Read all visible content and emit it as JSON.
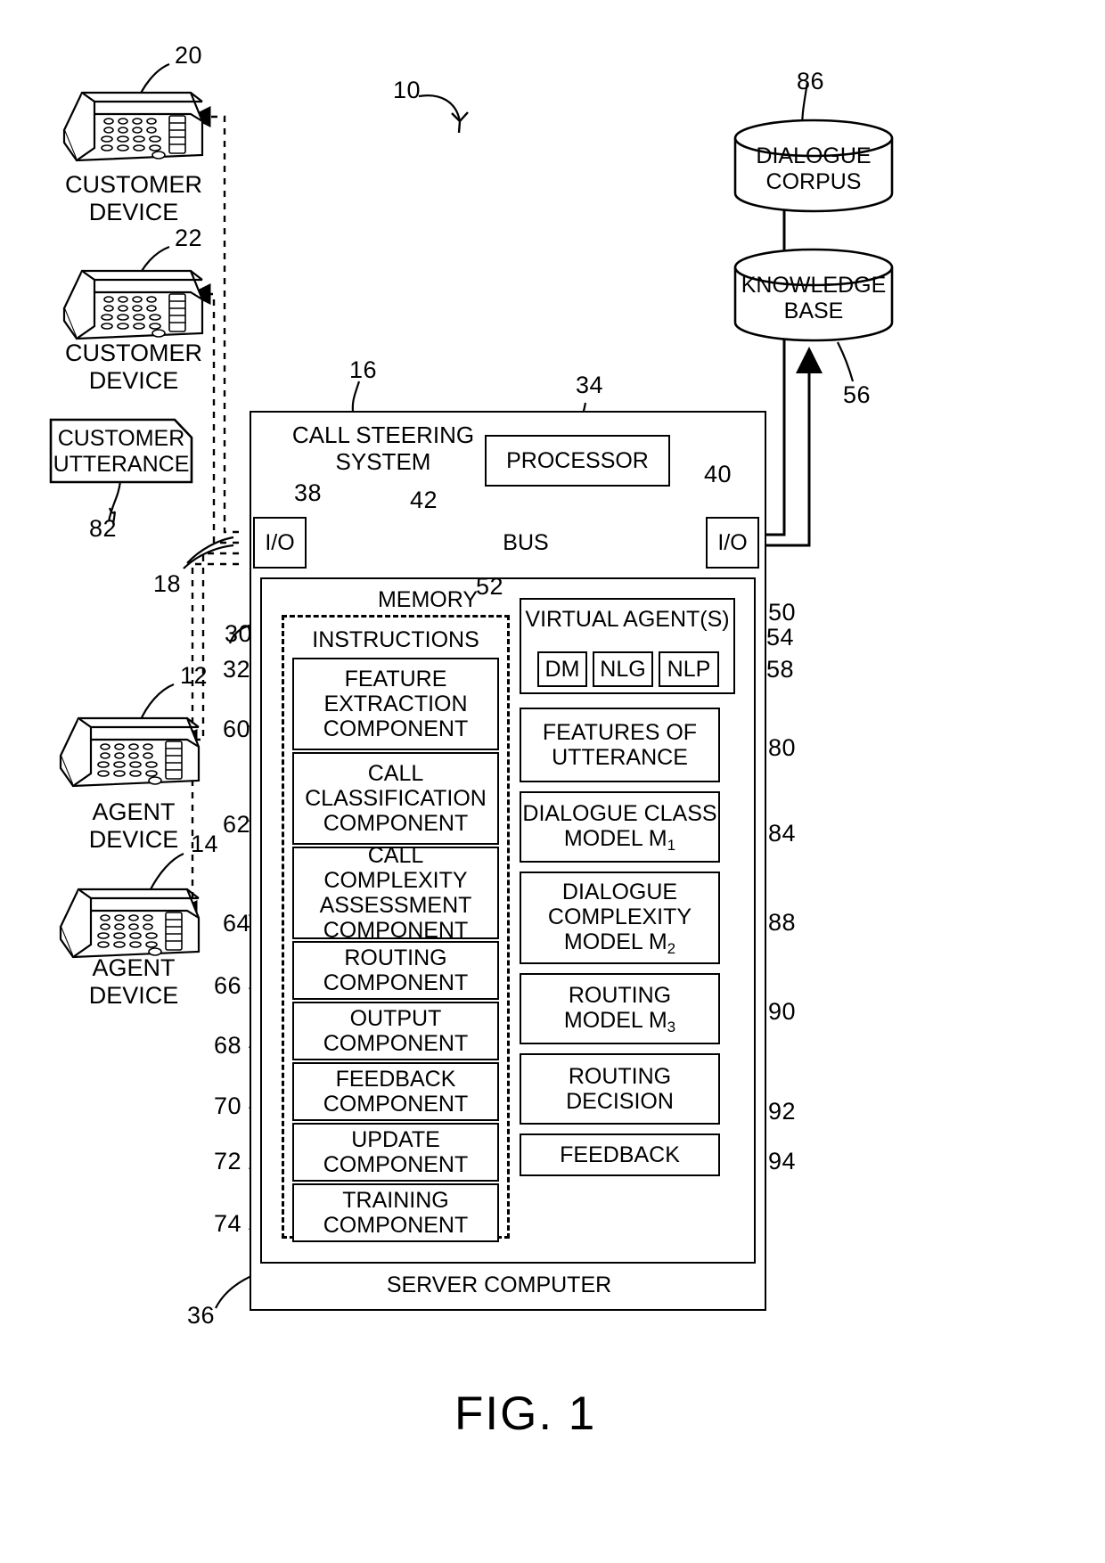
{
  "figure": {
    "caption": "FIG. 1",
    "system_ref": "10"
  },
  "external_devices": [
    {
      "label": "CUSTOMER\nDEVICE",
      "ref": "20",
      "name": "customer-device-20"
    },
    {
      "label": "CUSTOMER\nDEVICE",
      "ref": "22",
      "name": "customer-device-22"
    },
    {
      "label": "AGENT\nDEVICE",
      "ref": "12",
      "name": "agent-device-12"
    },
    {
      "label": "AGENT\nDEVICE",
      "ref": "14",
      "name": "agent-device-14"
    }
  ],
  "customer_utterance": {
    "label": "CUSTOMER\nUTTERANCE",
    "ref": "82"
  },
  "network_ref": "18",
  "databases": [
    {
      "label": "DIALOGUE\nCORPUS",
      "ref": "86",
      "name": "dialogue-corpus"
    },
    {
      "label": "KNOWLEDGE\nBASE",
      "ref": "56",
      "name": "knowledge-base"
    }
  ],
  "system": {
    "title": "CALL STEERING\nSYSTEM",
    "ref": "16",
    "processor": {
      "label": "PROCESSOR",
      "ref": "34"
    },
    "bus": {
      "label": "BUS",
      "ref": "42"
    },
    "io_left": {
      "label": "I/O",
      "ref": "38"
    },
    "io_right": {
      "label": "I/O",
      "ref": "40"
    },
    "memory": {
      "label": "MEMORY",
      "ref": "30"
    },
    "instructions": {
      "label": "INSTRUCTIONS",
      "ref": "32"
    },
    "server": {
      "label": "SERVER COMPUTER",
      "ref": "36"
    }
  },
  "components": [
    {
      "label": "FEATURE\nEXTRACTION\nCOMPONENT",
      "ref": "60"
    },
    {
      "label": "CALL\nCLASSIFICATION\nCOMPONENT",
      "ref": "62"
    },
    {
      "label": "CALL COMPLEXITY\nASSESSMENT\nCOMPONENT",
      "ref": "64"
    },
    {
      "label": "ROUTING\nCOMPONENT",
      "ref": "66"
    },
    {
      "label": "OUTPUT\nCOMPONENT",
      "ref": "68"
    },
    {
      "label": "FEEDBACK\nCOMPONENT",
      "ref": "70"
    },
    {
      "label": "UPDATE\nCOMPONENT",
      "ref": "72"
    },
    {
      "label": "TRAINING\nCOMPONENT",
      "ref": "74"
    }
  ],
  "virtual_agents": {
    "label": "VIRTUAL AGENT(S)",
    "ref": "50",
    "modules": [
      {
        "label": "DM",
        "ref": "52"
      },
      {
        "label": "NLG",
        "ref": "54"
      },
      {
        "label": "NLP",
        "ref": "58"
      }
    ]
  },
  "data_boxes": [
    {
      "label": "FEATURES OF\nUTTERANCE",
      "ref": "80"
    },
    {
      "label": "DIALOGUE CLASS\nMODEL M",
      "sub": "1",
      "ref": "84"
    },
    {
      "label": "DIALOGUE\nCOMPLEXITY\nMODEL M",
      "sub": "2",
      "ref": "88"
    },
    {
      "label": "ROUTING\nMODEL M",
      "sub": "3",
      "ref": "90"
    },
    {
      "label": "ROUTING\nDECISION",
      "ref": "92"
    },
    {
      "label": "FEEDBACK",
      "ref": "94"
    }
  ]
}
